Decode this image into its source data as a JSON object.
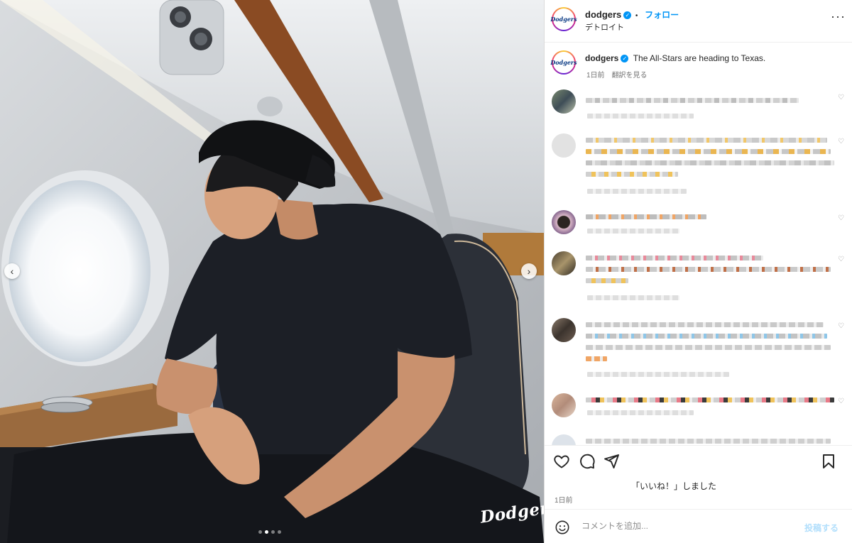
{
  "post": {
    "username": "dodgers",
    "follow_label": "フォロー",
    "separator": "•",
    "location": "デトロイト",
    "more_icon": "more-horizontal-icon"
  },
  "media": {
    "carousel_dots": 4,
    "active_dot": 1,
    "wordmark": "Dodgers",
    "prev_icon": "chevron-left-icon",
    "next_icon": "chevron-right-icon"
  },
  "caption": {
    "username": "dodgers",
    "text": "The All-Stars are heading to Texas.",
    "time": "1日前",
    "translate_label": "翻訳を見る"
  },
  "actions": {
    "like_icon": "heart-icon",
    "comment_icon": "comment-icon",
    "share_icon": "send-icon",
    "save_icon": "bookmark-icon",
    "liked_text": "「いいね！」しました",
    "date": "1日前"
  },
  "comment_box": {
    "emoji_icon": "emoji-icon",
    "placeholder": "コメントを追加...",
    "post_label": "投稿する"
  },
  "colors": {
    "accent": "#0095f6",
    "text": "#262626",
    "muted": "#737373",
    "post_disabled": "#b2dffc"
  }
}
